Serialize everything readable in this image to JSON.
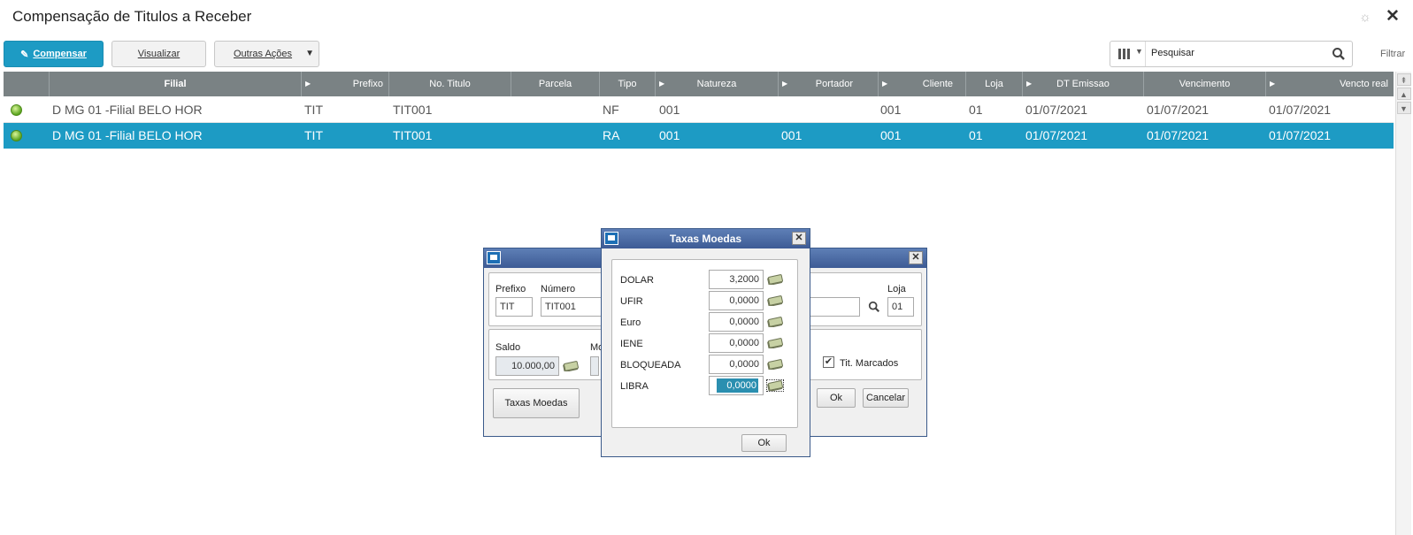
{
  "app": {
    "title": "Compensação de Titulos a Receber"
  },
  "toolbar": {
    "compensar": "Compensar",
    "visualizar": "Visualizar",
    "outras": "Outras Ações"
  },
  "search": {
    "value": "Pesquisar",
    "filtrar": "Filtrar"
  },
  "grid": {
    "headers": [
      "Filial",
      "Prefixo",
      "No. Titulo",
      "Parcela",
      "Tipo",
      "Natureza",
      "Portador",
      "Cliente",
      "Loja",
      "DT Emissao",
      "Vencimento",
      "Vencto real"
    ],
    "rows": [
      {
        "filial": "D MG 01 -Filial BELO HOR",
        "prefixo": "TIT",
        "titulo": "TIT001",
        "tipo": "NF",
        "natureza": "001",
        "portador": "",
        "cliente": "001",
        "loja": "01",
        "emissao": "01/07/2021",
        "vencimento": "01/07/2021",
        "vencto_real": "01/07/2021"
      },
      {
        "filial": "D MG 01 -Filial BELO HOR",
        "prefixo": "TIT",
        "titulo": "TIT001",
        "tipo": "RA",
        "natureza": "001",
        "portador": "001",
        "cliente": "001",
        "loja": "01",
        "emissao": "01/07/2021",
        "vencimento": "01/07/2021",
        "vencto_real": "01/07/2021"
      }
    ]
  },
  "back_dialog": {
    "prefixo_label": "Prefixo",
    "prefixo": "TIT",
    "numero_label": "Número",
    "numero": "TIT001",
    "loja_label": "Loja",
    "loja": "01",
    "saldo_label": "Saldo",
    "saldo": "10.000,00",
    "mo_label": "Mo",
    "tit_marcados": "Tit. Marcados",
    "taxas_moedas_btn": "Taxas Moedas",
    "ok": "Ok",
    "cancelar": "Cancelar"
  },
  "taxas_dialog": {
    "title": "Taxas Moedas",
    "ok": "Ok",
    "rates": [
      {
        "label": "DOLAR",
        "value": "3,2000"
      },
      {
        "label": "UFIR",
        "value": "0,0000"
      },
      {
        "label": "Euro",
        "value": "0,0000"
      },
      {
        "label": "IENE",
        "value": "0,0000"
      },
      {
        "label": "BLOQUEADA",
        "value": "0,0000"
      },
      {
        "label": "LIBRA",
        "value": "0,0000"
      }
    ]
  },
  "colors": {
    "accent": "#1d9bc4",
    "header_bg": "#7a8284",
    "dialog_title": "#3d5b95"
  }
}
